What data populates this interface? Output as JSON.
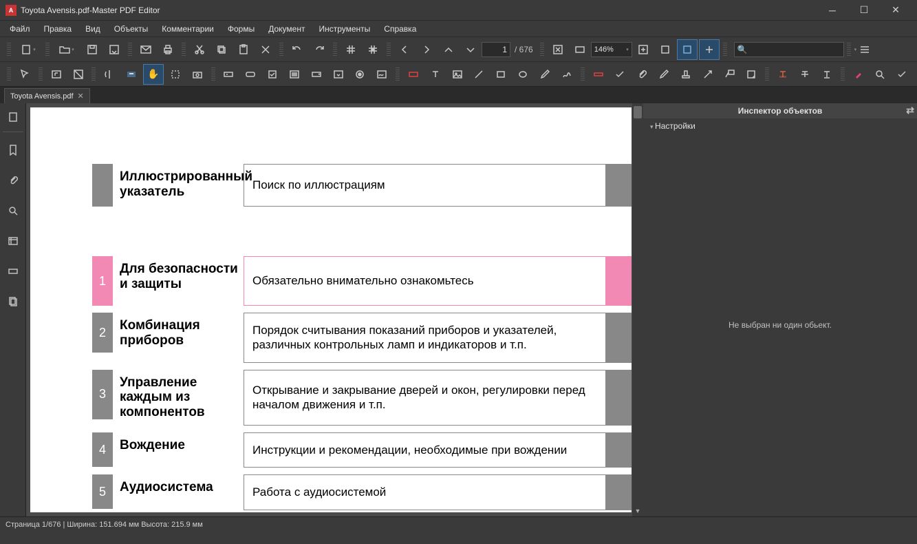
{
  "title": "Toyota Avensis.pdf-Master PDF Editor",
  "app_icon_letter": "A",
  "menu": [
    "Файл",
    "Правка",
    "Вид",
    "Объекты",
    "Комментарии",
    "Формы",
    "Документ",
    "Инструменты",
    "Справка"
  ],
  "page_input": "1",
  "page_total": "/ 676",
  "zoom": "146%",
  "search_placeholder": "",
  "tab": {
    "label": "Toyota Avensis.pdf"
  },
  "inspector": {
    "title": "Инспектор объектов",
    "section": "Настройки",
    "empty": "Не выбран ни один обьект."
  },
  "statusbar": "Страница 1/676 | Ширина: 151.694 мм Высота: 215.9 мм",
  "toc": [
    {
      "num": "",
      "title": "Иллюстрированный указатель",
      "desc": "Поиск по иллюстрациям",
      "color": "gray"
    },
    {
      "num": "1",
      "title": "Для безопасности и защиты",
      "desc": "Обязательно внимательно ознакомьтесь",
      "color": "pink"
    },
    {
      "num": "2",
      "title": "Комбинация приборов",
      "desc": "Порядок считывания показаний приборов и указателей, различных контрольных ламп и индикаторов и т.п.",
      "color": "gray"
    },
    {
      "num": "3",
      "title": "Управление каждым из компонентов",
      "desc": "Открывание и закрывание дверей и окон, регулировки перед началом движения и т.п.",
      "color": "gray"
    },
    {
      "num": "4",
      "title": "Вождение",
      "desc": "Инструкции и рекомендации, необходимые при вождении",
      "color": "gray"
    },
    {
      "num": "5",
      "title": "Аудиосистема",
      "desc": "Работа с аудиосистемой",
      "color": "gray"
    }
  ]
}
